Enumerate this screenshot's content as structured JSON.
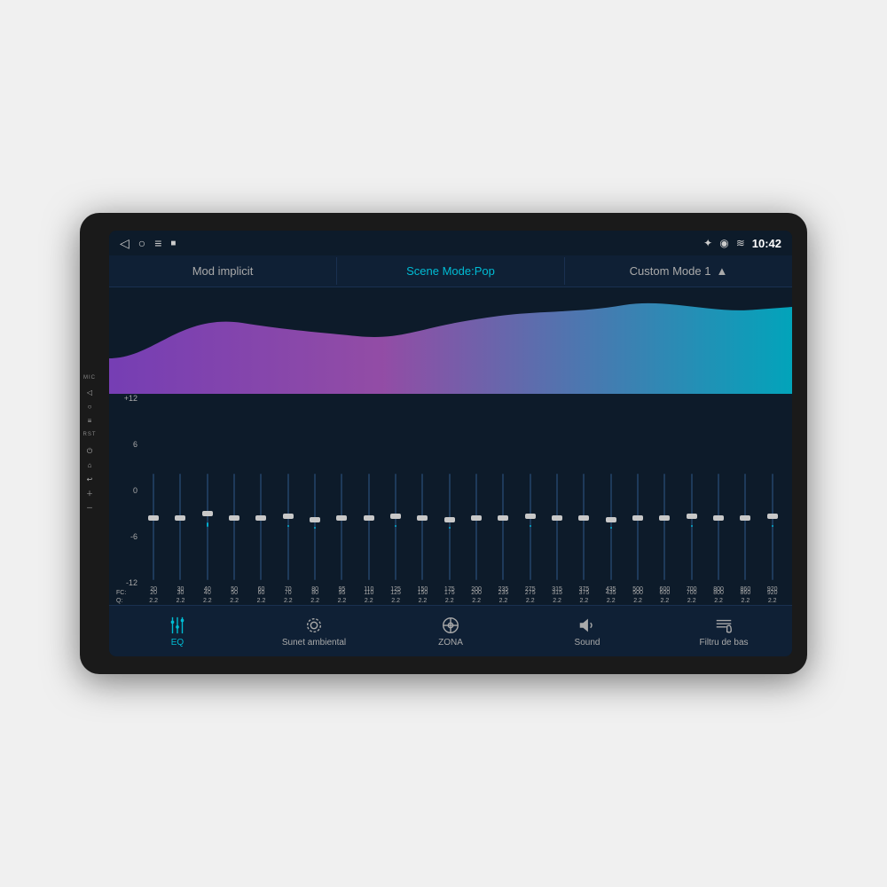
{
  "device": {
    "mic_label": "MIC",
    "rst_label": "RST"
  },
  "status_bar": {
    "time": "10:42",
    "icons": [
      "back",
      "home",
      "menu",
      "stop",
      "bluetooth",
      "location",
      "wifi"
    ]
  },
  "mode_bar": {
    "items": [
      {
        "label": "Mod implicit",
        "active": false
      },
      {
        "label": "Scene Mode:Pop",
        "active": true
      },
      {
        "label": "Custom Mode 1",
        "active": false
      }
    ],
    "arrow": "▲"
  },
  "eq": {
    "scale": [
      "+12",
      "6",
      "0",
      "-6",
      "-12"
    ],
    "frequencies": [
      "20",
      "30",
      "40",
      "50",
      "60",
      "70",
      "80",
      "95",
      "110",
      "125",
      "150",
      "175",
      "200",
      "235",
      "275",
      "315",
      "375",
      "435",
      "500",
      "600",
      "700",
      "800",
      "860",
      "920"
    ],
    "q_label": "Q:",
    "fc_label": "FC:",
    "q_values": [
      "2.2",
      "2.2",
      "2.2",
      "2.2",
      "2.2",
      "2.2",
      "2.2",
      "2.2",
      "2.2",
      "2.2",
      "2.2",
      "2.2",
      "2.2",
      "2.2",
      "2.2",
      "2.2",
      "2.2",
      "2.2",
      "2.2",
      "2.2",
      "2.2",
      "2.2",
      "2.2",
      "2.2"
    ],
    "slider_positions": [
      0.5,
      0.5,
      0.45,
      0.5,
      0.5,
      0.48,
      0.52,
      0.5,
      0.5,
      0.48,
      0.5,
      0.52,
      0.5,
      0.5,
      0.48,
      0.5,
      0.5,
      0.52,
      0.5,
      0.5,
      0.48,
      0.5,
      0.5,
      0.48
    ]
  },
  "bottom_nav": {
    "items": [
      {
        "id": "eq",
        "label": "EQ",
        "icon": "⚙",
        "active": true
      },
      {
        "id": "sunet",
        "label": "Sunet ambiental",
        "icon": "◎",
        "active": false
      },
      {
        "id": "zona",
        "label": "ZONA",
        "icon": "◎",
        "active": false
      },
      {
        "id": "sound",
        "label": "Sound",
        "icon": "🔊",
        "active": false
      },
      {
        "id": "filtru",
        "label": "Filtru de bas",
        "icon": "≡",
        "active": false
      }
    ]
  }
}
